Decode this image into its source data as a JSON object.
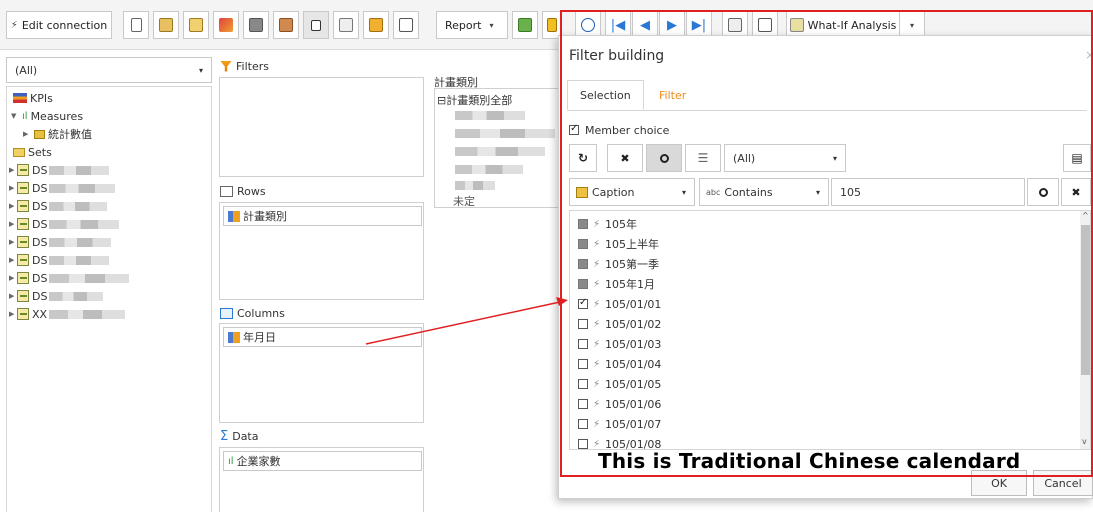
{
  "toolbar": {
    "edit_connection": "Edit connection",
    "edit_glyph": "⚡",
    "report_label": "Report",
    "whatif_label": "What-If Analysis",
    "caret": "▾",
    "nav_first": "◀",
    "nav_prev": "◀",
    "nav_next": "▶",
    "nav_last": "▶"
  },
  "left": {
    "select_value": "(All)",
    "tree": {
      "kpis": "KPIs",
      "measures": "Measures",
      "measure_child": "統計數值",
      "sets": "Sets",
      "ds_prefix": "DS",
      "xx_prefix": "XX"
    }
  },
  "panels": {
    "filters_title": "Filters",
    "rows_title": "Rows",
    "rows_chip": "計畫類別",
    "columns_title": "Columns",
    "columns_chip": "年月日",
    "data_title": "Data",
    "data_chip": "企業家數"
  },
  "preview": {
    "header": "計畫類別",
    "root_item": "⊟計畫類別全部",
    "partial_text": "未定"
  },
  "dialog": {
    "title": "Filter building",
    "close": "×",
    "tabs": [
      "Selection",
      "Filter"
    ],
    "member_choice_label": "Member choice",
    "member_choice_checked": true,
    "refresh_glyph": "↻",
    "clear_glyph": "✖",
    "search_glyph": "🔍",
    "list_glyph": "☰",
    "level_select": "(All)",
    "menu_glyph": "▤",
    "caption_select": "Caption",
    "match_prefix": "abc",
    "match_select": "Contains",
    "search_value": "105",
    "members": [
      {
        "label": "105年",
        "state": "partial"
      },
      {
        "label": "105上半年",
        "state": "partial"
      },
      {
        "label": "105第一季",
        "state": "partial"
      },
      {
        "label": "105年1月",
        "state": "partial"
      },
      {
        "label": "105/01/01",
        "state": "checked"
      },
      {
        "label": "105/01/02",
        "state": "unchecked"
      },
      {
        "label": "105/01/03",
        "state": "unchecked"
      },
      {
        "label": "105/01/04",
        "state": "unchecked"
      },
      {
        "label": "105/01/05",
        "state": "unchecked"
      },
      {
        "label": "105/01/06",
        "state": "unchecked"
      },
      {
        "label": "105/01/07",
        "state": "unchecked"
      },
      {
        "label": "105/01/08",
        "state": "unchecked"
      }
    ],
    "bolt_glyph": "⚡",
    "ok_label": "OK",
    "cancel_label": "Cancel"
  },
  "annotation": {
    "text": "This is  Traditional Chinese calendard",
    "color": "#e02020"
  },
  "colors": {
    "accent_orange": "#f28b1b",
    "border": "#c9c9c9",
    "annotation_red": "#e02020"
  }
}
